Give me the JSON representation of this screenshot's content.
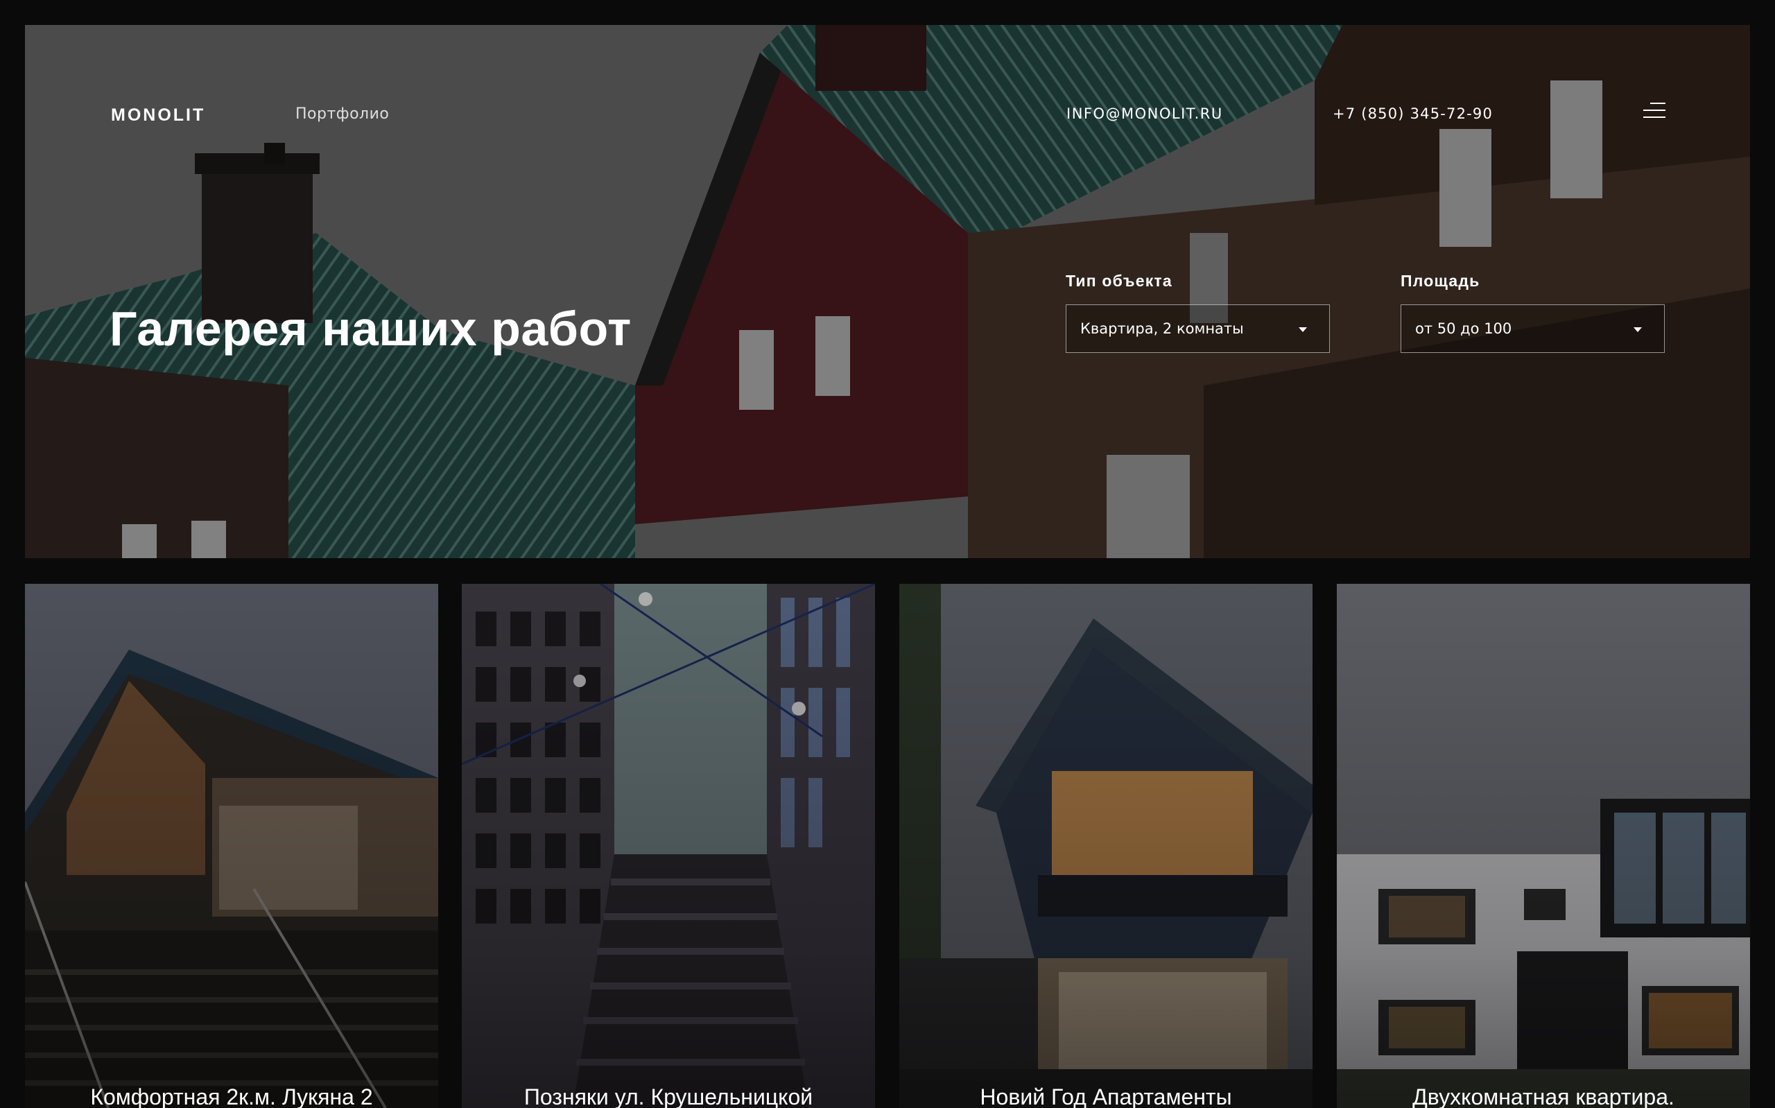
{
  "nav": {
    "logo": "MONOLIT",
    "portfolio_link": "Портфолио",
    "email": "INFO@MONOLIT.RU",
    "phone": "+7 (850) 345-72-90",
    "menu_icon": "hamburger-menu-icon"
  },
  "hero": {
    "title": "Галерея наших работ",
    "filters": [
      {
        "label": "Тип объекта",
        "value": "Квартира, 2 комнаты"
      },
      {
        "label": "Площадь",
        "value": "от 50 до 100"
      }
    ]
  },
  "cards": [
    {
      "title": "Комфортная 2к.м. Лукяна 2"
    },
    {
      "title": "Позняки ул. Крушельницкой"
    },
    {
      "title": "Новий Год Апартаменты"
    },
    {
      "title": "Двухкомнатная квартира."
    }
  ],
  "colors": {
    "background": "#0a0a0a",
    "roof_teal": "#2d5f58",
    "brick_red": "#4a1a1e"
  }
}
